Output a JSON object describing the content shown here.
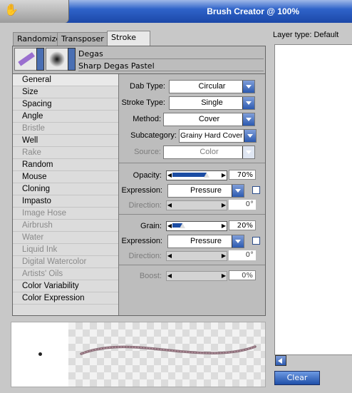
{
  "window": {
    "title": "Brush Creator @ 100%"
  },
  "tabs": [
    {
      "label": "Randomizer"
    },
    {
      "label": "Transposer"
    },
    {
      "label": "Stroke Designer"
    }
  ],
  "brush": {
    "category": "Degas",
    "variant": "Sharp Degas Pastel"
  },
  "sidebar": {
    "items": [
      {
        "label": "General",
        "enabled": true
      },
      {
        "label": "Size",
        "enabled": true
      },
      {
        "label": "Spacing",
        "enabled": true
      },
      {
        "label": "Angle",
        "enabled": true
      },
      {
        "label": "Bristle",
        "enabled": false
      },
      {
        "label": "Well",
        "enabled": true
      },
      {
        "label": "Rake",
        "enabled": false
      },
      {
        "label": "Random",
        "enabled": true
      },
      {
        "label": "Mouse",
        "enabled": true
      },
      {
        "label": "Cloning",
        "enabled": true
      },
      {
        "label": "Impasto",
        "enabled": true
      },
      {
        "label": "Image Hose",
        "enabled": false
      },
      {
        "label": "Airbrush",
        "enabled": false
      },
      {
        "label": "Water",
        "enabled": false
      },
      {
        "label": "Liquid Ink",
        "enabled": false
      },
      {
        "label": "Digital Watercolor",
        "enabled": false
      },
      {
        "label": "Artists' Oils",
        "enabled": false
      },
      {
        "label": "Color Variability",
        "enabled": true
      },
      {
        "label": "Color Expression",
        "enabled": true
      }
    ]
  },
  "general": {
    "dab_type": {
      "label": "Dab Type:",
      "value": "Circular"
    },
    "stroke_type": {
      "label": "Stroke Type:",
      "value": "Single"
    },
    "method": {
      "label": "Method:",
      "value": "Cover"
    },
    "subcategory": {
      "label": "Subcategory:",
      "value": "Grainy Hard Cover"
    },
    "source": {
      "label": "Source:",
      "value": "Color"
    },
    "opacity": {
      "label": "Opacity:",
      "value": "70%",
      "fraction": 0.7
    },
    "opacity_expression": {
      "label": "Expression:",
      "value": "Pressure"
    },
    "opacity_direction": {
      "label": "Direction:",
      "value": "0°"
    },
    "grain": {
      "label": "Grain:",
      "value": "20%",
      "fraction": 0.2
    },
    "grain_expression": {
      "label": "Expression:",
      "value": "Pressure"
    },
    "grain_direction": {
      "label": "Direction:",
      "value": "0°"
    },
    "boost": {
      "label": "Boost:",
      "value": "0%"
    }
  },
  "layer_panel": {
    "type_label": "Layer type: Default",
    "clear_label": "Clear"
  },
  "colors": {
    "accent": "#1b4ca3",
    "title_bar": "#2f63c9"
  }
}
